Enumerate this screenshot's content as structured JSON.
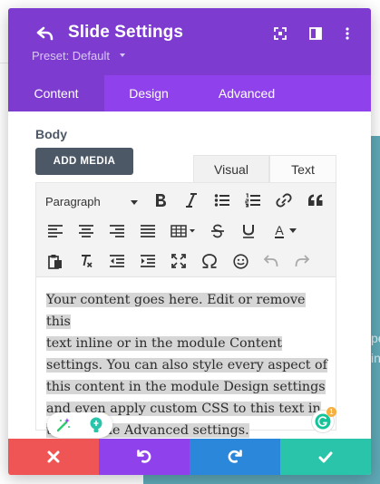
{
  "background": {
    "side_text": [
      "pe",
      "in"
    ]
  },
  "header": {
    "title": "Slide Settings",
    "preset": "Preset: Default",
    "icons": [
      "back-arrow-icon",
      "fullscreen-icon",
      "split-view-icon",
      "more-vertical-icon"
    ]
  },
  "tabs": [
    {
      "label": "Content",
      "active": true
    },
    {
      "label": "Design",
      "active": false
    },
    {
      "label": "Advanced",
      "active": false
    }
  ],
  "body": {
    "label": "Body",
    "add_media_label": "ADD MEDIA",
    "editor_tabs": [
      {
        "label": "Visual",
        "active": true
      },
      {
        "label": "Text",
        "active": false
      }
    ],
    "toolbar": {
      "format_select_value": "Paragraph",
      "text_color_letter": "A",
      "buttons": [
        "bold-icon",
        "italic-icon",
        "bullet-list-icon",
        "numbered-list-icon",
        "link-icon",
        "blockquote-icon",
        "align-left-icon",
        "align-center-icon",
        "align-right-icon",
        "justify-icon",
        "table-icon",
        "strikethrough-icon",
        "underline-icon",
        "text-color-icon",
        "paste-icon",
        "clear-format-icon",
        "outdent-icon",
        "indent-icon",
        "fullscreen-icon",
        "omega-icon",
        "emoji-icon",
        "undo-icon",
        "redo-icon"
      ]
    },
    "content_lines": [
      "Your content goes here. Edit or remove this",
      "text inline or in the module Content",
      "settings. You can also style every aspect of",
      "this content in the module Design settings",
      "and even apply custom CSS to this text in",
      "the module Advanced settings."
    ],
    "grammarly_badge": "1"
  },
  "footer": {
    "buttons": [
      {
        "name": "cancel",
        "color": "#ef5555"
      },
      {
        "name": "undo",
        "color": "#8f42ec"
      },
      {
        "name": "redo",
        "color": "#2b87da"
      },
      {
        "name": "save",
        "color": "#29c4a9"
      }
    ]
  },
  "colors": {
    "header": "#7e3bd0",
    "tabs": "#8f42ec",
    "add_media": "#4c5866"
  }
}
